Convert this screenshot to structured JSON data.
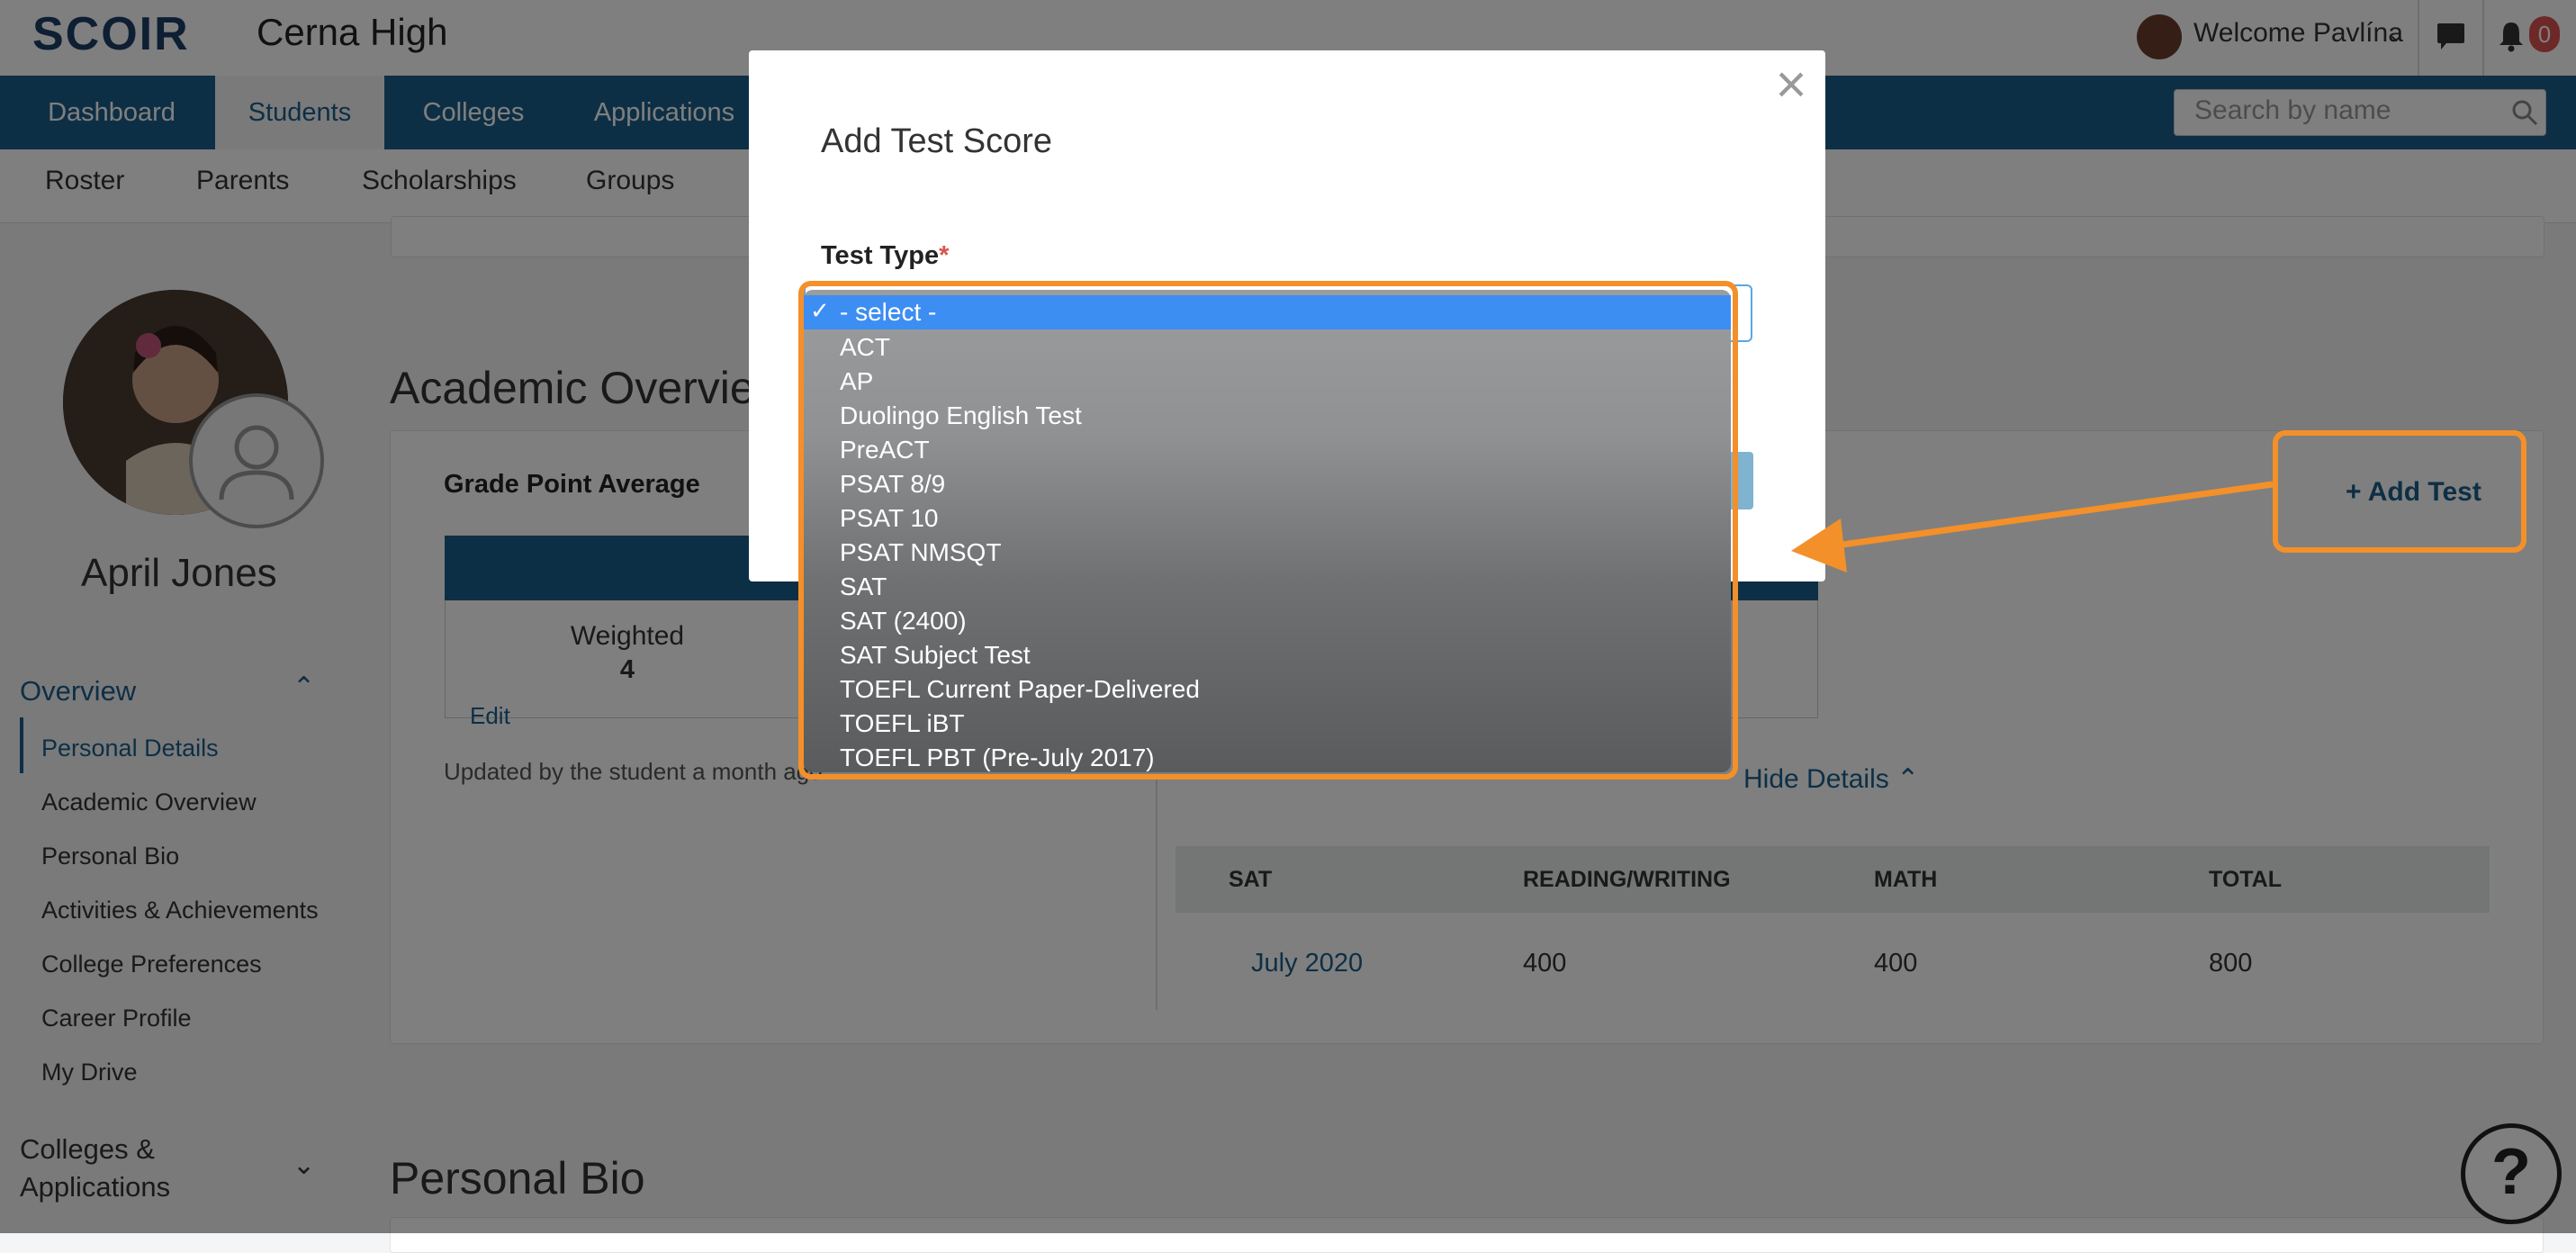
{
  "header": {
    "logo": "SCOIR",
    "school": "Cerna High",
    "welcome": "Welcome Pavlína",
    "notification_count": "0"
  },
  "nav": {
    "tabs": [
      "Dashboard",
      "Students",
      "Colleges",
      "Applications"
    ],
    "active_tab": "Students",
    "search_placeholder": "Search by name"
  },
  "subnav": {
    "tabs": [
      "Roster",
      "Parents",
      "Scholarships",
      "Groups"
    ]
  },
  "sidebar": {
    "student_name": "April Jones",
    "overview_label": "Overview",
    "items": [
      "Personal Details",
      "Academic Overview",
      "Personal Bio",
      "Activities & Achievements",
      "College Preferences",
      "Career Profile",
      "My Drive"
    ],
    "active_item": "Personal Details",
    "colleges_applications": "Colleges & Applications"
  },
  "main": {
    "academic_title": "Academic Overview",
    "gpa_label": "Grade Point Average",
    "weighted_label": "Weighted",
    "weighted_value": "4",
    "edit_label": "Edit",
    "updated_text": "Updated by the student a month ago",
    "add_test_label": "Add Test",
    "hide_details_label": "Hide Details",
    "sat_table": {
      "headers": [
        "SAT",
        "READING/WRITING",
        "MATH",
        "TOTAL"
      ],
      "row": [
        "July 2020",
        "400",
        "400",
        "800"
      ]
    },
    "bio_title": "Personal Bio"
  },
  "modal": {
    "title": "Add Test Score",
    "test_type_label": "Test Type",
    "required_mark": "*",
    "options": [
      "- select -",
      "ACT",
      "AP",
      "Duolingo English Test",
      "PreACT",
      "PSAT 8/9",
      "PSAT 10",
      "PSAT NMSQT",
      "SAT",
      "SAT (2400)",
      "SAT Subject Test",
      "TOEFL Current Paper-Delivered",
      "TOEFL iBT",
      "TOEFL PBT (Pre-July 2017)"
    ],
    "selected_option": "- select -",
    "check_mark": "✓"
  },
  "help": {
    "label": "?"
  },
  "colors": {
    "nav_blue": "#1b5f8a",
    "highlight_orange": "#f39029",
    "select_blue": "#3d8ef2"
  }
}
